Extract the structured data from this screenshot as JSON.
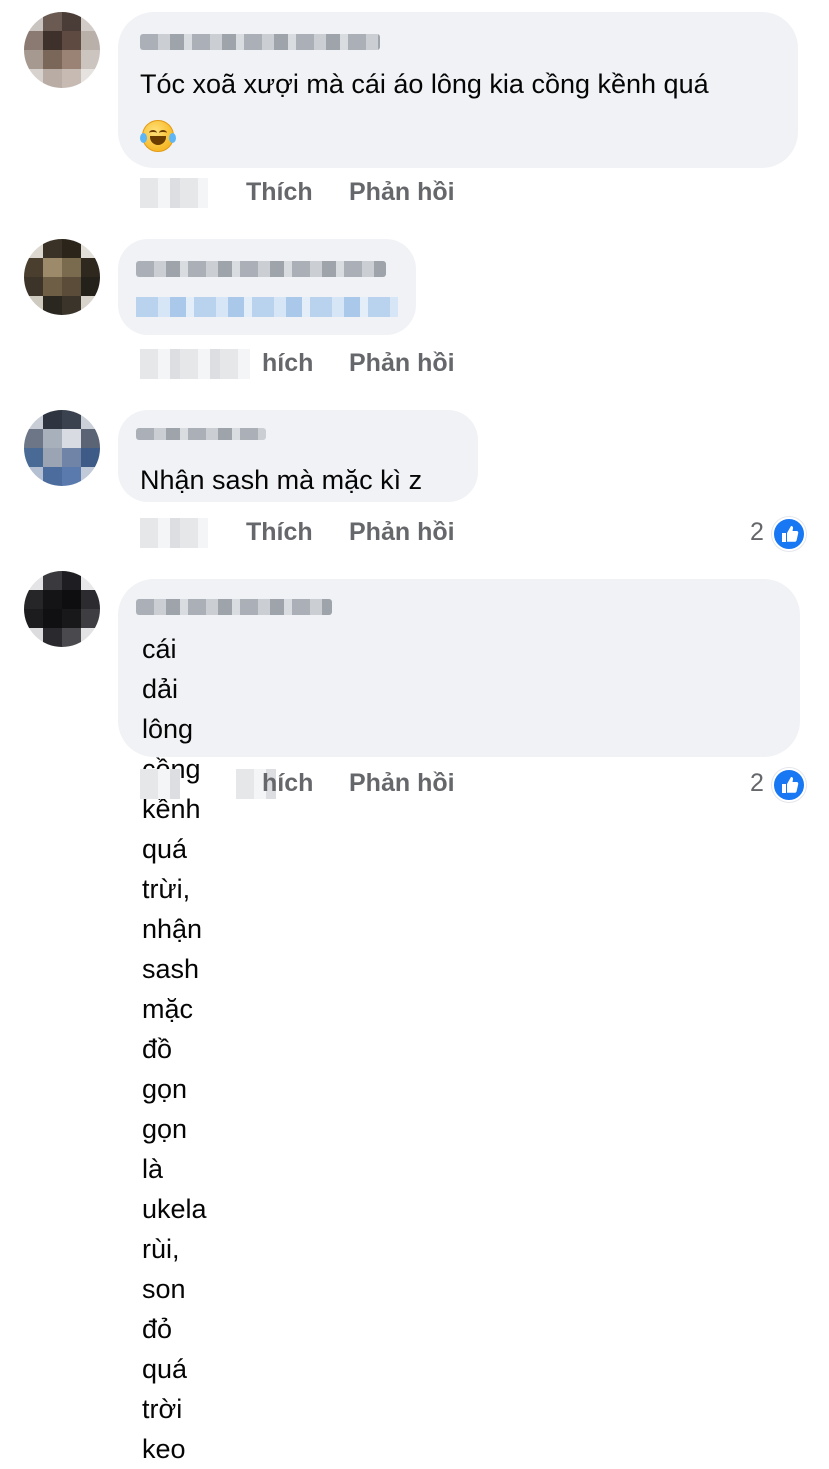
{
  "actions": {
    "like": "Thích",
    "reply": "Phản hồi",
    "like_partial": "hích"
  },
  "colors": {
    "bubble": "#f0f2f5",
    "action_text": "#65676b",
    "like_blue": "#1877f2"
  },
  "comments": [
    {
      "text": "Tóc xoã xượi mà cái áo lông kia cồng kềnh quá",
      "emoji": "laughing-with-tears-emoji",
      "reaction_count": ""
    },
    {
      "text": "",
      "reaction_count": ""
    },
    {
      "text": "Nhận sash mà mặc kì z",
      "reaction_count": "2"
    },
    {
      "text": "cái dải lông cồng kềnh quá trừi, nhận sash\nmặc đồ gọn gọn là ukela rùi, son đỏ quá trời\nkeo",
      "reaction_count": "2"
    }
  ]
}
